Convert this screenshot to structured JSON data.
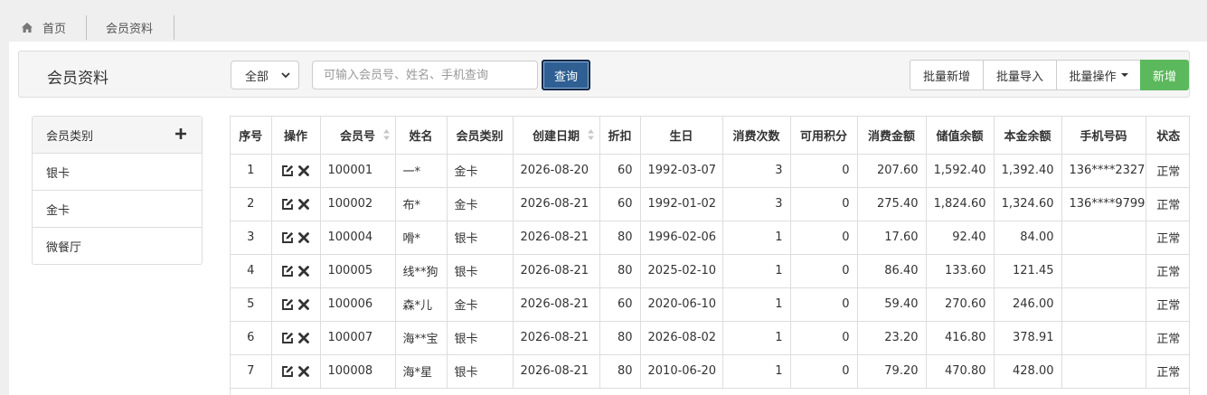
{
  "tabs": {
    "home": "首页",
    "member": "会员资料"
  },
  "toolbar": {
    "title": "会员资料",
    "filter_selected": "全部",
    "search_placeholder": "可输入会员号、姓名、手机查询",
    "search_value": "",
    "query_label": "查询",
    "buttons": [
      "批量新增",
      "批量导入",
      "批量操作",
      "新增"
    ]
  },
  "sidebar": {
    "header": "会员类别",
    "items": [
      "银卡",
      "金卡",
      "微餐厅"
    ]
  },
  "table": {
    "columns": [
      "序号",
      "操作",
      "会员号",
      "姓名",
      "会员类别",
      "创建日期",
      "折扣",
      "生日",
      "消费次数",
      "可用积分",
      "消费金额",
      "储值余额",
      "本金余额",
      "手机号码",
      "状态"
    ],
    "rows": [
      [
        "1",
        "",
        "100001",
        "一*",
        "金卡",
        "2026-08-20",
        "60",
        "1992-03-07",
        "3",
        "0",
        "207.60",
        "1,592.40",
        "1,392.40",
        "136****2327",
        "正常"
      ],
      [
        "2",
        "",
        "100002",
        "布*",
        "金卡",
        "2026-08-21",
        "60",
        "1992-01-02",
        "3",
        "0",
        "275.40",
        "1,824.60",
        "1,324.60",
        "136****9799",
        "正常"
      ],
      [
        "3",
        "",
        "100004",
        "嗗*",
        "银卡",
        "2026-08-21",
        "80",
        "1996-02-06",
        "1",
        "0",
        "17.60",
        "92.40",
        "84.00",
        "",
        "正常"
      ],
      [
        "4",
        "",
        "100005",
        "线**狗",
        "银卡",
        "2026-08-21",
        "80",
        "2025-02-10",
        "1",
        "0",
        "86.40",
        "133.60",
        "121.45",
        "",
        "正常"
      ],
      [
        "5",
        "",
        "100006",
        "森*儿",
        "金卡",
        "2026-08-21",
        "60",
        "2020-06-10",
        "1",
        "0",
        "59.40",
        "270.60",
        "246.00",
        "",
        "正常"
      ],
      [
        "6",
        "",
        "100007",
        "海**宝",
        "银卡",
        "2026-08-21",
        "80",
        "2026-08-02",
        "1",
        "0",
        "23.20",
        "416.80",
        "378.91",
        "",
        "正常"
      ],
      [
        "7",
        "",
        "100008",
        "海*星",
        "银卡",
        "2026-08-21",
        "80",
        "2010-06-20",
        "1",
        "0",
        "79.20",
        "470.80",
        "428.00",
        "",
        "正常"
      ]
    ]
  },
  "colors": {
    "query_button": "#2f5f93",
    "new_button": "#5cb85c",
    "panel": "#f5f5f5",
    "border": "#dddddd"
  }
}
